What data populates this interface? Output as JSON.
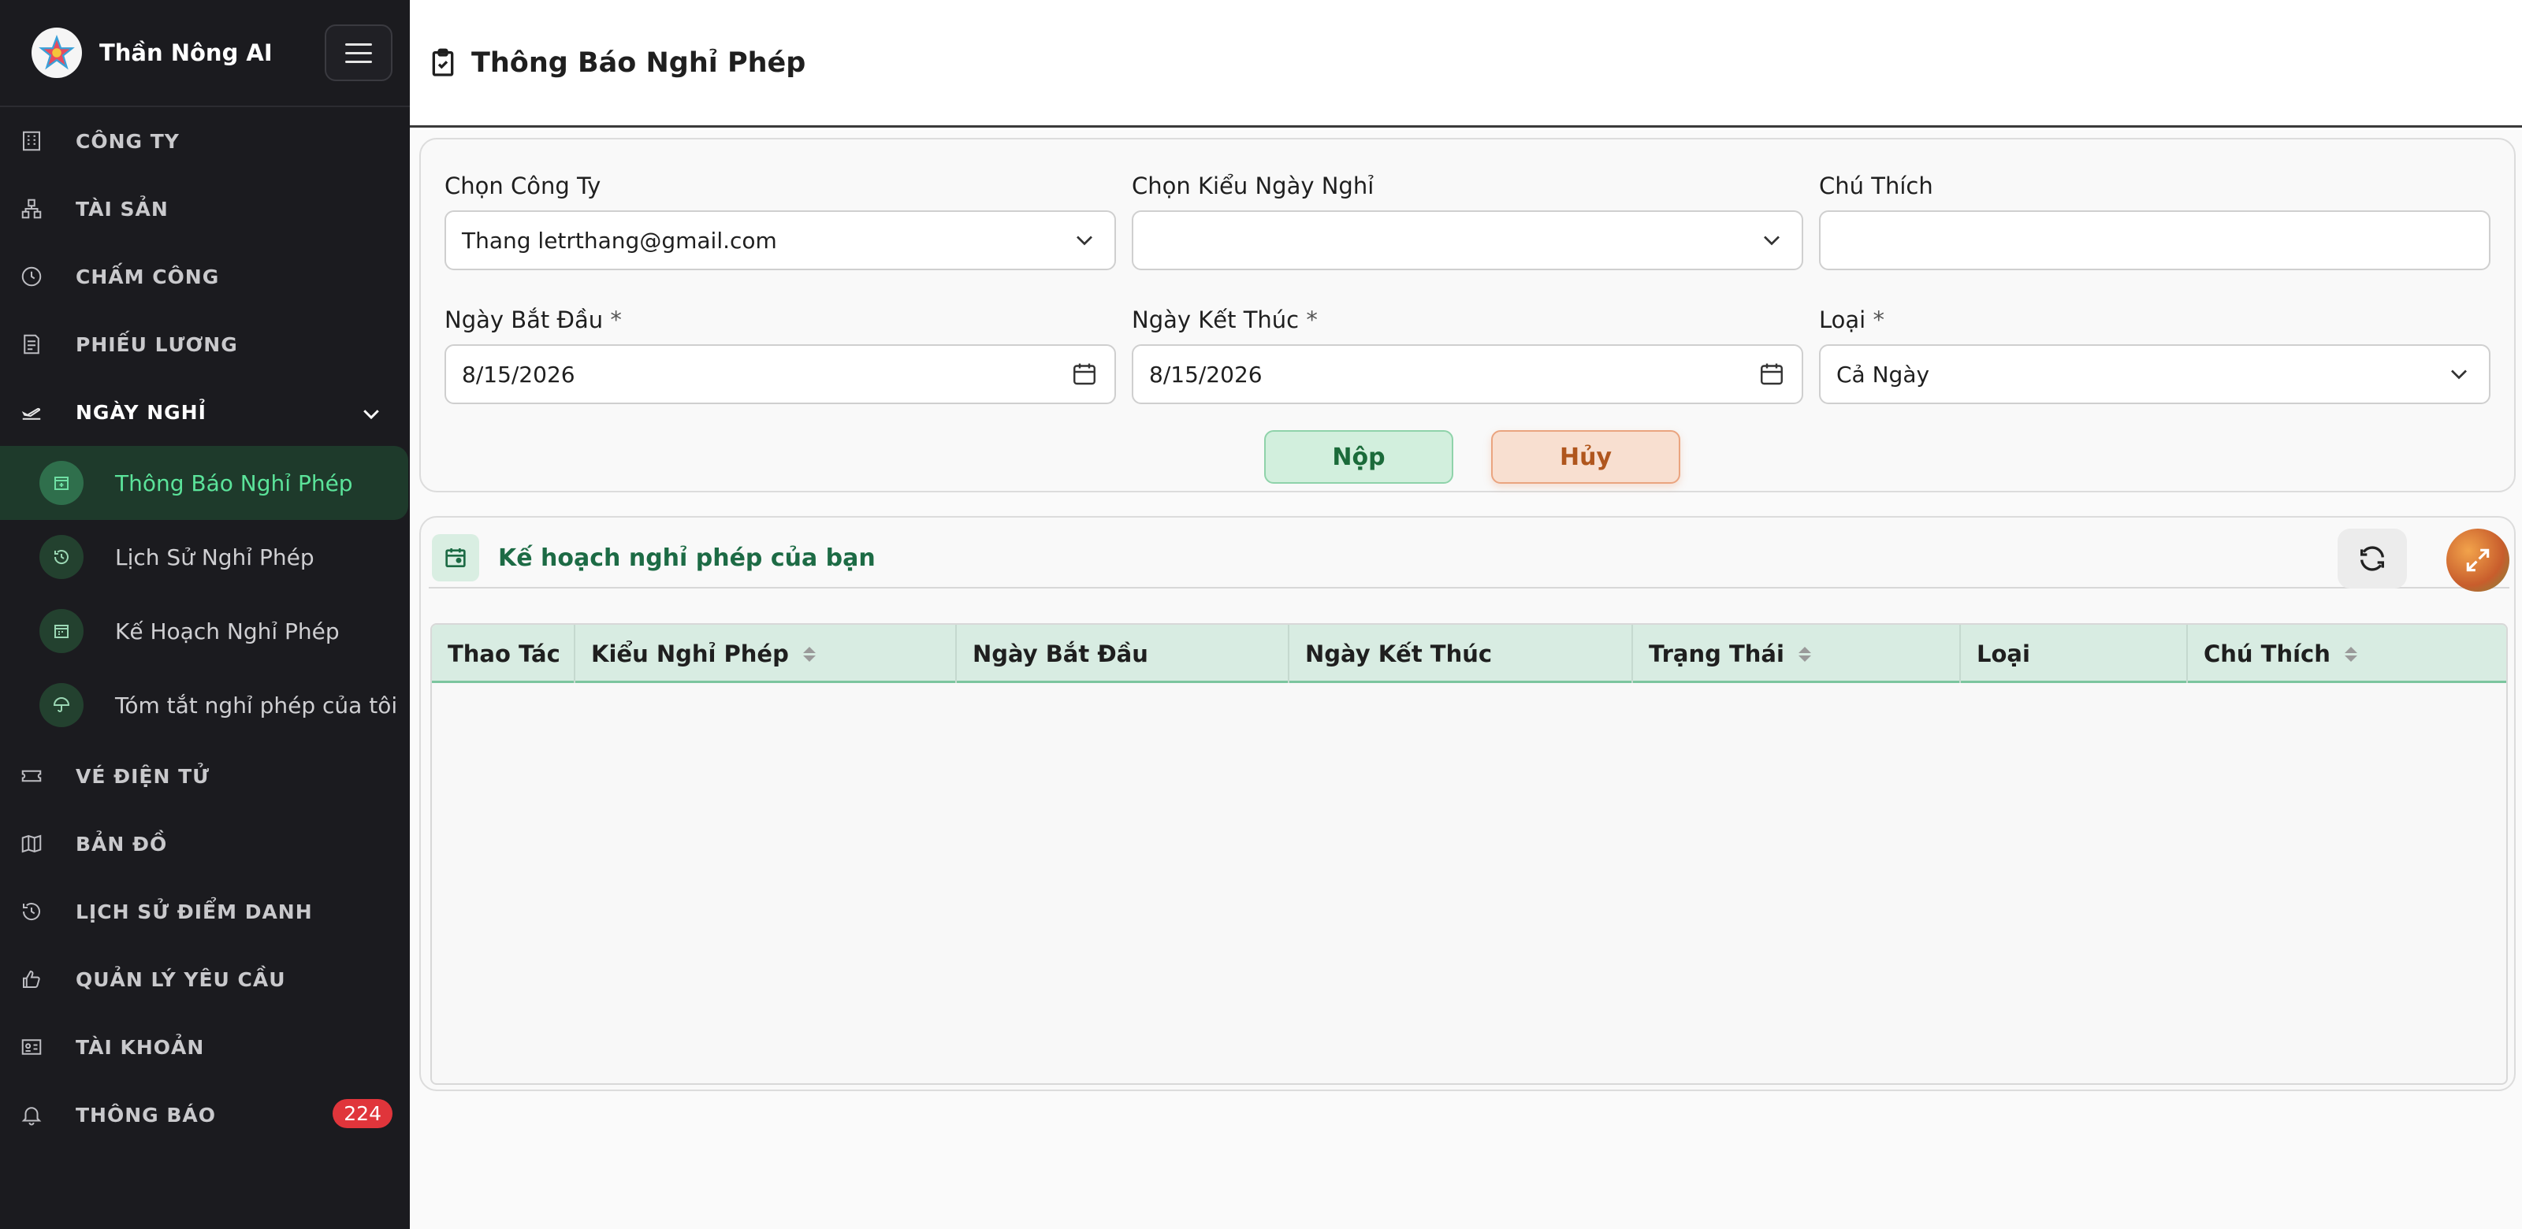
{
  "app": {
    "name": "Thần Nông AI"
  },
  "page": {
    "title": "Thông Báo Nghỉ Phép"
  },
  "sidebar": {
    "items": [
      {
        "label": "CÔNG TY",
        "icon": "building-icon"
      },
      {
        "label": "TÀI SẢN",
        "icon": "assets-icon"
      },
      {
        "label": "CHẤM CÔNG",
        "icon": "clock-icon"
      },
      {
        "label": "PHIẾU LƯƠNG",
        "icon": "payslip-icon"
      },
      {
        "label": "NGÀY NGHỈ",
        "icon": "plane-icon"
      },
      {
        "label": "VÉ ĐIỆN TỬ",
        "icon": "ticket-icon"
      },
      {
        "label": "BẢN ĐỒ",
        "icon": "map-icon"
      },
      {
        "label": "LỊCH SỬ ĐIỂM DANH",
        "icon": "history-icon"
      },
      {
        "label": "QUẢN LÝ YÊU CẦU",
        "icon": "thumbs-up-icon"
      },
      {
        "label": "TÀI KHOẢN",
        "icon": "id-card-icon"
      },
      {
        "label": "THÔNG BÁO",
        "icon": "bell-icon",
        "badge": "224"
      }
    ],
    "subitems": [
      {
        "label": "Thông Báo Nghỉ Phép",
        "active": true
      },
      {
        "label": "Lịch Sử Nghỉ Phép"
      },
      {
        "label": "Kế Hoạch Nghỉ Phép"
      },
      {
        "label": "Tóm tắt nghỉ phép của tôi"
      }
    ]
  },
  "form": {
    "company": {
      "label": "Chọn Công Ty",
      "value": "Thang letrthang@gmail.com"
    },
    "leave_type": {
      "label": "Chọn Kiểu Ngày Nghỉ",
      "value": ""
    },
    "note": {
      "label": "Chú Thích",
      "value": ""
    },
    "start_date": {
      "label": "Ngày Bắt Đầu",
      "required": "*",
      "value": "8/15/2026"
    },
    "end_date": {
      "label": "Ngày Kết Thúc",
      "required": "*",
      "value": "8/15/2026"
    },
    "kind": {
      "label": "Loại",
      "required": "*",
      "value": "Cả Ngày"
    },
    "submit_label": "Nộp",
    "cancel_label": "Hủy"
  },
  "table": {
    "title": "Kế hoạch nghỉ phép của bạn",
    "columns": [
      {
        "label": "Thao Tác",
        "sortable": false
      },
      {
        "label": "Kiểu Nghỉ Phép",
        "sortable": true
      },
      {
        "label": "Ngày Bắt Đầu",
        "sortable": false
      },
      {
        "label": "Ngày Kết Thúc",
        "sortable": false
      },
      {
        "label": "Trạng Thái",
        "sortable": true
      },
      {
        "label": "Loại",
        "sortable": false
      },
      {
        "label": "Chú Thích",
        "sortable": true
      }
    ],
    "rows": []
  },
  "colors": {
    "sidebar_bg": "#1b1b1f",
    "accent_green": "#5be39a",
    "badge_red": "#e0353b"
  }
}
